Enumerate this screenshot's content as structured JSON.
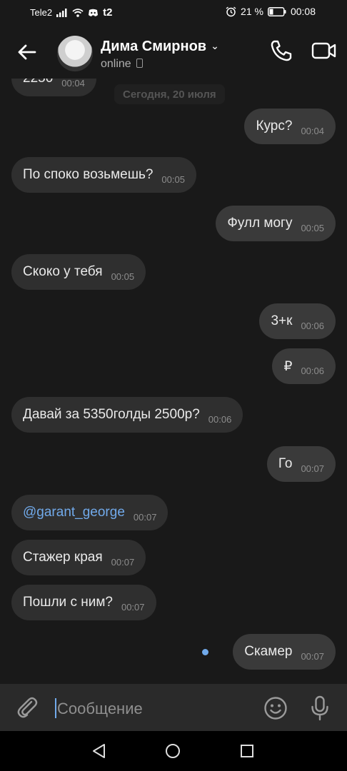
{
  "status_bar": {
    "carrier": "Tele2",
    "carrier_logo": "t2",
    "battery": "21 %",
    "time": "00:08",
    "icons": [
      "signal-icon",
      "wifi-icon",
      "discord-icon",
      "alarm-icon",
      "battery-icon"
    ]
  },
  "header": {
    "contact_name": "Дима Смирнов",
    "presence": "online",
    "icons": [
      "back-arrow-icon",
      "chevron-down-icon",
      "phone-call-icon",
      "video-call-icon"
    ]
  },
  "chat": {
    "date_chip": "Сегодня, 20 июля",
    "partial_top": {
      "text": "2250",
      "time": "00:04"
    },
    "messages": [
      {
        "dir": "out",
        "text": "Курс?",
        "time": "00:04"
      },
      {
        "dir": "in",
        "text": "По споко возьмешь?",
        "time": "00:05"
      },
      {
        "dir": "out",
        "text": "Фулл могу",
        "time": "00:05"
      },
      {
        "dir": "in",
        "text": "Скоко у тебя",
        "time": "00:05"
      },
      {
        "dir": "out",
        "text": "3+к",
        "time": "00:06"
      },
      {
        "dir": "out",
        "text": "₽",
        "time": "00:06"
      },
      {
        "dir": "in",
        "text": "Давай за 5350голды 2500р?",
        "time": "00:06"
      },
      {
        "dir": "out",
        "text": "Го",
        "time": "00:07"
      },
      {
        "dir": "in",
        "text": "@garant_george",
        "time": "00:07",
        "mention": true
      },
      {
        "dir": "in",
        "text": "Стажер края",
        "time": "00:07"
      },
      {
        "dir": "in",
        "text": "Пошли с ним?",
        "time": "00:07"
      },
      {
        "dir": "out",
        "text": "Скамер",
        "time": "00:07",
        "unread": true
      }
    ]
  },
  "input": {
    "placeholder": "Сообщение",
    "icons": [
      "attach-clip-icon",
      "emoji-icon",
      "microphone-icon"
    ]
  },
  "navbar": {
    "icons": [
      "nav-back-icon",
      "nav-home-icon",
      "nav-recents-icon"
    ]
  },
  "colors": {
    "background": "#191919",
    "bubble_in": "#2f2f2f",
    "bubble_out": "#3a3a3a",
    "accent": "#71aaeb"
  }
}
